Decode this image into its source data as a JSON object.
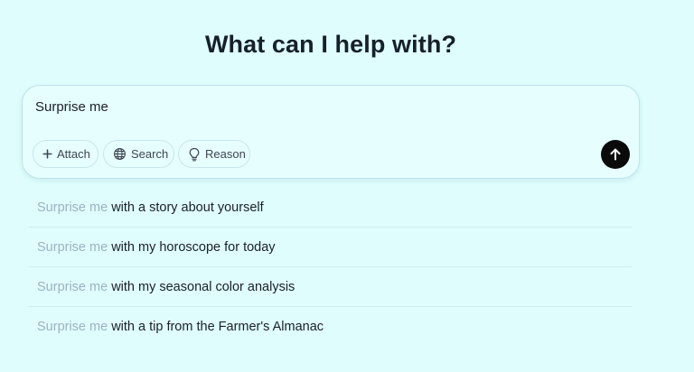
{
  "heading": "What can I help with?",
  "composer": {
    "value": "Surprise me",
    "placeholder": ""
  },
  "chips": {
    "attach_label": "Attach",
    "search_label": "Search",
    "reason_label": "Reason"
  },
  "send": {
    "icon": "arrow-up-icon"
  },
  "suggestions": [
    {
      "prefix": "Surprise me",
      "rest": " with a story about yourself"
    },
    {
      "prefix": "Surprise me",
      "rest": " with my horoscope for today"
    },
    {
      "prefix": "Surprise me",
      "rest": " with my seasonal color analysis"
    },
    {
      "prefix": "Surprise me",
      "rest": " with a tip from the Farmer's Almanac"
    }
  ],
  "colors": {
    "background": "#dffdfd",
    "composer_bg": "#e6fefe",
    "send_button": "#0a0a0a",
    "suggestion_prefix": "#9cb2c2"
  }
}
